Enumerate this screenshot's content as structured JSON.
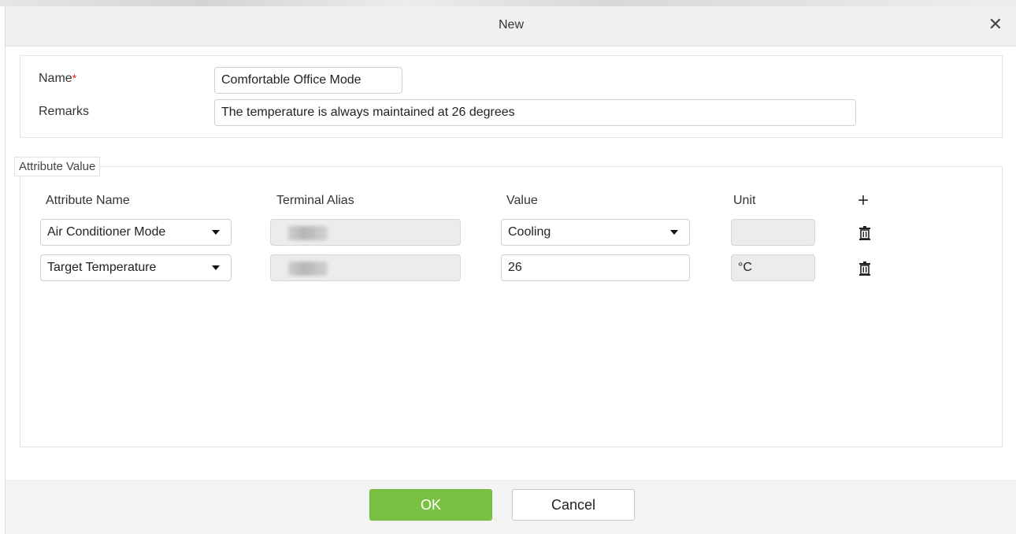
{
  "dialog": {
    "title": "New",
    "close_glyph": "✕"
  },
  "form": {
    "name_label": "Name",
    "required_mark": "*",
    "name_value": "Comfortable Office Mode",
    "remarks_label": "Remarks",
    "remarks_value": "The temperature is always maintained at 26 degrees"
  },
  "attributes": {
    "legend": "Attribute Value",
    "headers": {
      "attribute_name": "Attribute Name",
      "terminal_alias": "Terminal Alias",
      "value": "Value",
      "unit": "Unit"
    },
    "add_icon": "+",
    "rows": [
      {
        "attribute_name": "Air Conditioner Mode",
        "terminal_alias": "",
        "value": "Cooling",
        "value_is_select": true,
        "unit": ""
      },
      {
        "attribute_name": "Target Temperature",
        "terminal_alias": "",
        "value": "26",
        "value_is_select": false,
        "unit": "°C"
      }
    ]
  },
  "footer": {
    "ok_label": "OK",
    "cancel_label": "Cancel"
  },
  "colors": {
    "ok_button": "#7ac143",
    "required": "#e02020"
  }
}
